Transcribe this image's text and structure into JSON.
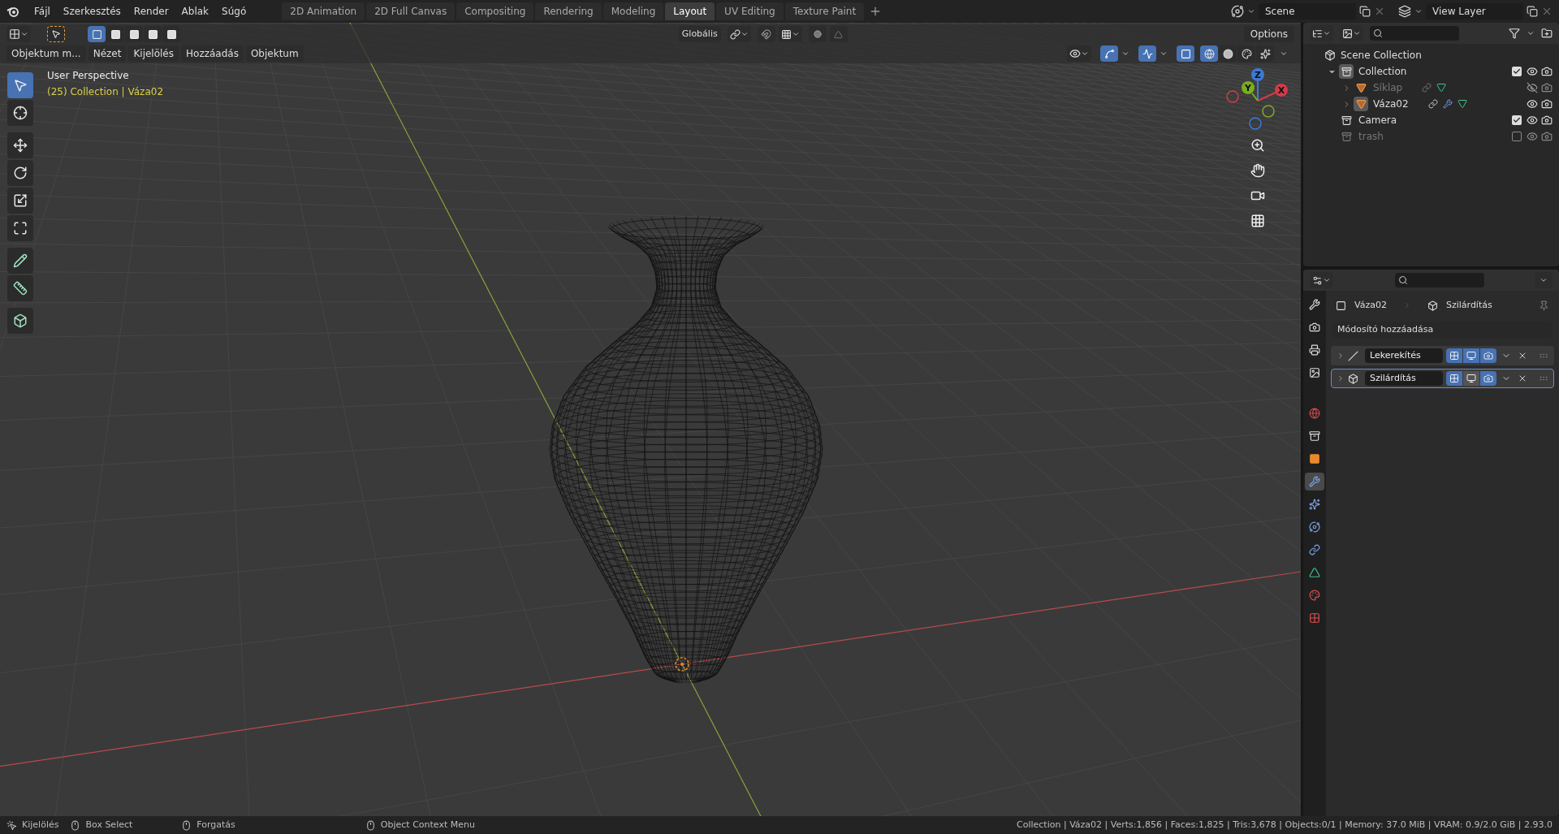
{
  "menu": [
    "Fájl",
    "Szerkesztés",
    "Render",
    "Ablak",
    "Súgó"
  ],
  "workspaces": [
    {
      "label": "2D Animation",
      "selected": false
    },
    {
      "label": "2D Full Canvas",
      "selected": false
    },
    {
      "label": "Compositing",
      "selected": false
    },
    {
      "label": "Rendering",
      "selected": false
    },
    {
      "label": "Modeling",
      "selected": false
    },
    {
      "label": "Layout",
      "selected": true
    },
    {
      "label": "UV Editing",
      "selected": false
    },
    {
      "label": "Texture Paint",
      "selected": false
    }
  ],
  "scene": {
    "value": "Scene"
  },
  "view_layer": {
    "value": "View Layer"
  },
  "tool_header": {
    "select_modes": [
      {
        "selected": true
      },
      {
        "selected": false
      },
      {
        "selected": false
      },
      {
        "selected": false
      },
      {
        "selected": false
      }
    ],
    "transform_orientation": "Globális",
    "snap": {
      "on": false
    },
    "proportional": {
      "on": false
    },
    "options": "Options"
  },
  "viewport_header": {
    "mode": "Objektum m...",
    "menus": [
      "Nézet",
      "Kijelölés",
      "Hozzáadás",
      "Objektum"
    ],
    "toggles": [
      {
        "kind": "gizmo",
        "on": true
      },
      {
        "kind": "overlay",
        "on": true
      },
      {
        "kind": "xray",
        "on": true
      }
    ],
    "shading": [
      {
        "kind": "wireframe",
        "selected": true
      },
      {
        "kind": "solid",
        "selected": false
      },
      {
        "kind": "material",
        "selected": false
      },
      {
        "kind": "rendered",
        "selected": false
      }
    ]
  },
  "viewport": {
    "view_name": "User Perspective",
    "collection_info": "(25) Collection | Váza02",
    "gizmo_axes": [
      "X",
      "Y",
      "Z"
    ]
  },
  "toolbar": [
    {
      "kind": "select",
      "selected": true
    },
    {
      "kind": "cursor",
      "selected": false
    },
    {
      "kind": "move",
      "selected": false
    },
    {
      "kind": "rotate",
      "selected": false
    },
    {
      "kind": "scale",
      "selected": false
    },
    {
      "kind": "transform",
      "selected": false
    },
    {
      "kind": "annotate",
      "selected": false
    },
    {
      "kind": "measure",
      "selected": false
    },
    {
      "kind": "add_cube",
      "selected": false
    }
  ],
  "outliner": {
    "tree": {
      "label": "Scene Collection",
      "kind": "scene",
      "children": [
        {
          "label": "Collection",
          "kind": "collection",
          "active": true,
          "expanded": true,
          "checked": true,
          "visible": true,
          "children": [
            {
              "label": "Síklap",
              "kind": "mesh",
              "active": false,
              "expanded": false,
              "visible": false,
              "modifiers": false
            },
            {
              "label": "Váza02",
              "kind": "mesh",
              "active": true,
              "expanded": false,
              "visible": true,
              "modifiers": true
            }
          ]
        },
        {
          "label": "Camera",
          "kind": "collection",
          "active": false,
          "checked": true,
          "visible": true
        },
        {
          "label": "trash",
          "kind": "collection",
          "active": false,
          "checked": false,
          "visible": true
        }
      ]
    }
  },
  "properties": {
    "tabs": [
      {
        "kind": "tool",
        "selected": false
      },
      {
        "kind": "render",
        "selected": false
      },
      {
        "kind": "output",
        "selected": false
      },
      {
        "kind": "view_layer",
        "selected": false
      },
      {
        "kind": "world",
        "selected": false
      },
      {
        "kind": "collection",
        "selected": false
      },
      {
        "kind": "object",
        "selected": false
      },
      {
        "kind": "modifiers",
        "selected": true
      },
      {
        "kind": "particles",
        "selected": false
      },
      {
        "kind": "physics",
        "selected": false
      },
      {
        "kind": "constraints",
        "selected": false
      },
      {
        "kind": "data",
        "selected": false
      },
      {
        "kind": "material",
        "selected": false
      },
      {
        "kind": "texture",
        "selected": false
      }
    ],
    "breadcrumb": [
      "Váza02",
      "Szilárdítás"
    ],
    "add_modifier": "Módosító hozzáadása",
    "modifiers": [
      {
        "name": "Lekerekítés",
        "kind": "bevel",
        "active": false,
        "edit_mode": true,
        "viewport": true,
        "render": true
      },
      {
        "name": "Szilárdítás",
        "kind": "solidify",
        "active": true,
        "edit_mode": true,
        "viewport": false,
        "render": true
      }
    ]
  },
  "status_bar": {
    "hints": [
      "Kijelölés",
      "Box Select",
      "Forgatás",
      "Object Context Menu"
    ],
    "stats": "Collection | Váza02 | Verts:1,856 | Faces:1,825 | Tris:3,678 | Objects:0/1 | Memory: 37.0 MiB | VRAM: 0.9/2.0 GiB | 2.93.0"
  }
}
